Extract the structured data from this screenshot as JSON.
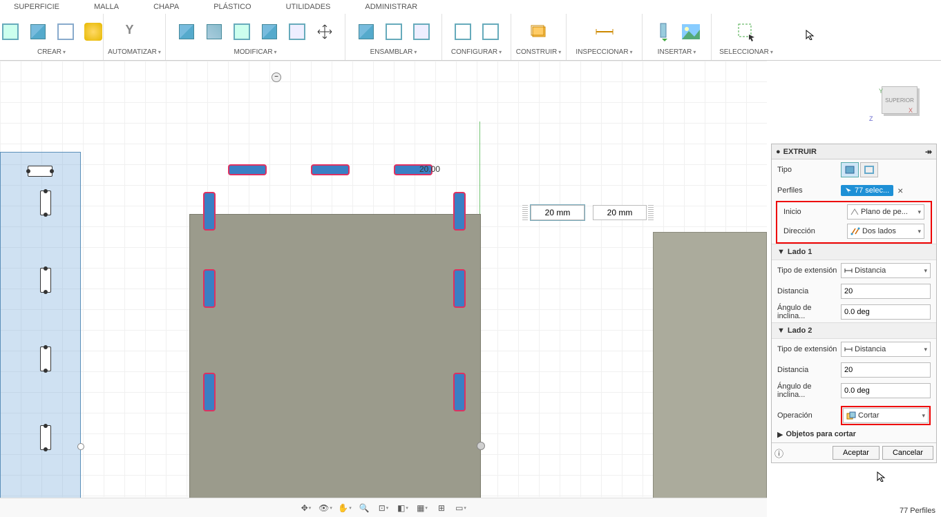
{
  "menu_tabs": [
    "SUPERFICIE",
    "MALLA",
    "CHAPA",
    "PLÁSTICO",
    "UTILIDADES",
    "ADMINISTRAR"
  ],
  "ribbon": {
    "groups": [
      {
        "label": "CREAR"
      },
      {
        "label": "AUTOMATIZAR"
      },
      {
        "label": "MODIFICAR"
      },
      {
        "label": "ENSAMBLAR"
      },
      {
        "label": "CONFIGURAR"
      },
      {
        "label": "CONSTRUIR"
      },
      {
        "label": "INSPECCIONAR"
      },
      {
        "label": "INSERTAR"
      },
      {
        "label": "SELECCIONAR"
      }
    ]
  },
  "viewcube": {
    "face": "SUPERIOR",
    "y": "Y",
    "x": "X",
    "z": "Z"
  },
  "dims": {
    "label": "20.00",
    "box1": "20 mm",
    "box2": "20 mm"
  },
  "panel": {
    "title": "EXTRUIR",
    "rows": {
      "tipo": "Tipo",
      "perfiles": "Perfiles",
      "perfiles_chip": "77 selec...",
      "inicio": "Inicio",
      "inicio_val": "Plano de pe...",
      "direccion": "Dirección",
      "direccion_val": "Dos lados",
      "lado1": "Lado 1",
      "tipoext": "Tipo de extensión",
      "tipoext_val": "Distancia",
      "distancia": "Distancia",
      "distancia_val": "20",
      "angulo": "Ángulo de inclina...",
      "angulo_val": "0.0 deg",
      "lado2": "Lado 2",
      "tipoext2_val": "Distancia",
      "distancia2_val": "20",
      "angulo2_val": "0.0 deg",
      "operacion": "Operación",
      "operacion_val": "Cortar",
      "objetos": "Objetos para cortar"
    },
    "aceptar": "Aceptar",
    "cancelar": "Cancelar"
  },
  "status": "77 Perfiles"
}
